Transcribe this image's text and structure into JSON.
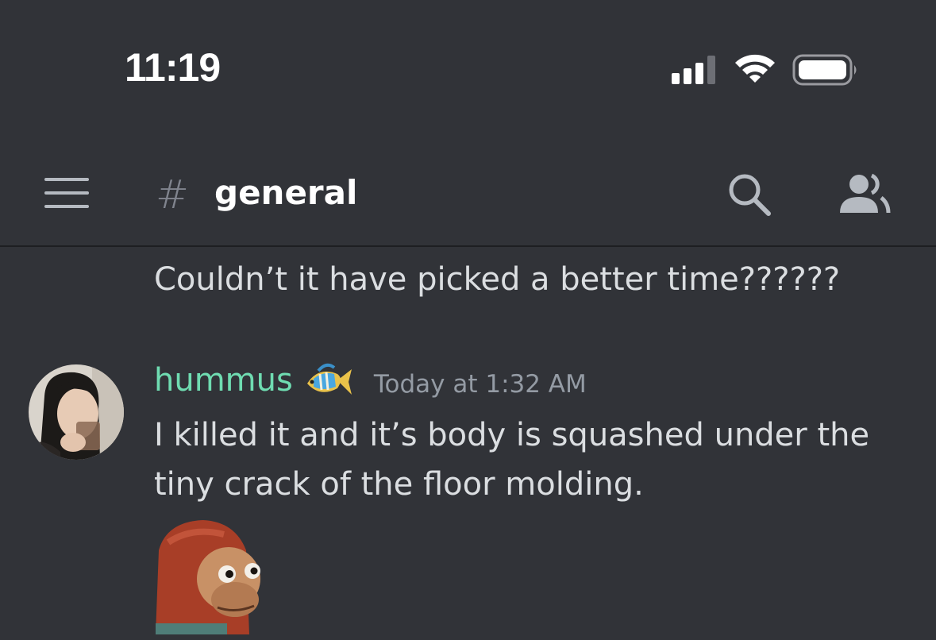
{
  "status_bar": {
    "time": "11:19",
    "icons": [
      "cellular-signal-icon",
      "wifi-icon",
      "battery-icon"
    ]
  },
  "header": {
    "menu_icon": "hamburger-menu-icon",
    "channel_prefix": "#",
    "channel_name": "general",
    "actions": [
      "search-icon",
      "members-icon"
    ]
  },
  "messages": {
    "continuation_text": "Couldn’t it have picked a better time??????",
    "message": {
      "username": "hummus",
      "username_color": "#6fdcb1",
      "badge_icon": "tropical-fish-icon",
      "timestamp": "Today at 1:32 AM",
      "text": "I killed it and it’s body is squashed under the tiny crack of the floor molding.",
      "sticker": "puppet-monkey-sticker"
    }
  },
  "colors": {
    "background": "#313338",
    "text": "#dbdee1",
    "muted": "#949ba4",
    "username": "#6fdcb1"
  }
}
